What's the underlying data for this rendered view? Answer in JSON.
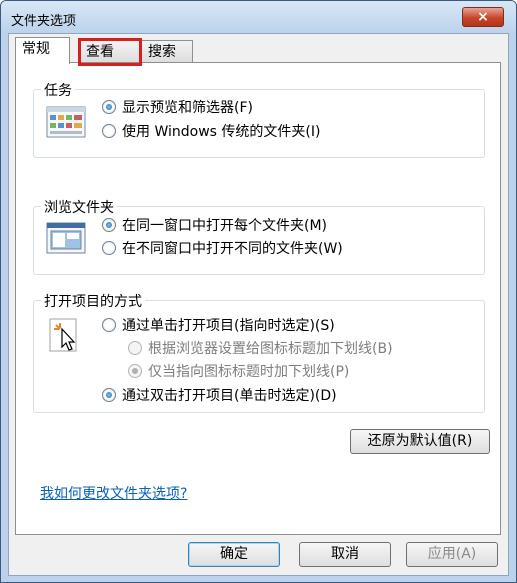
{
  "window": {
    "title": "文件夹选项",
    "close_label": "×"
  },
  "tabs": [
    {
      "label": "常规",
      "active": true
    },
    {
      "label": "查看",
      "active": false
    },
    {
      "label": "搜索",
      "active": false
    }
  ],
  "groups": {
    "tasks": {
      "title": "任务",
      "icon": "preview-pane-icon",
      "options": [
        {
          "label": "显示预览和筛选器(F)",
          "checked": true
        },
        {
          "label": "使用 Windows 传统的文件夹(I)",
          "checked": false
        }
      ]
    },
    "browse": {
      "title": "浏览文件夹",
      "icon": "folder-window-icon",
      "options": [
        {
          "label": "在同一窗口中打开每个文件夹(M)",
          "checked": true
        },
        {
          "label": "在不同窗口中打开不同的文件夹(W)",
          "checked": false
        }
      ]
    },
    "click": {
      "title": "打开项目的方式",
      "icon": "cursor-click-icon",
      "options": [
        {
          "label": "通过单击打开项目(指向时选定)(S)",
          "checked": false
        },
        {
          "label": "根据浏览器设置给图标标题加下划线(B)",
          "checked": false,
          "disabled": true
        },
        {
          "label": "仅当指向图标标题时加下划线(P)",
          "checked": true,
          "disabled": true
        },
        {
          "label": "通过双击打开项目(单击时选定)(D)",
          "checked": true
        }
      ]
    }
  },
  "restore_defaults_label": "还原为默认值(R)",
  "help_link_label": "我如何更改文件夹选项?",
  "buttons": {
    "ok": "确定",
    "cancel": "取消",
    "apply": "应用(A)"
  },
  "colors": {
    "highlight_box": "#d62020",
    "link": "#0a5fbf",
    "title_bar": "#bcd3eb"
  }
}
